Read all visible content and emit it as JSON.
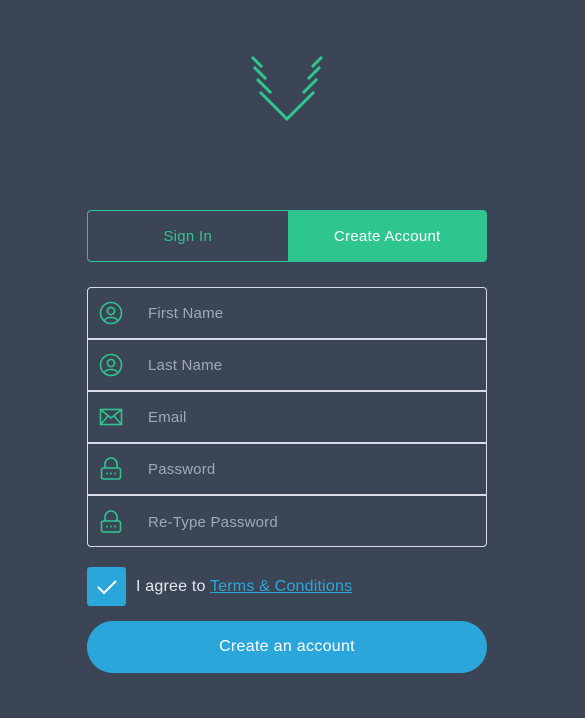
{
  "brand": {
    "logo_icon": "chevron-v-logo-icon",
    "accent_color": "#2ec58f"
  },
  "tabs": [
    {
      "label": "Sign In",
      "active": false
    },
    {
      "label": "Create Account",
      "active": true
    }
  ],
  "form": {
    "fields": [
      {
        "placeholder": "First Name",
        "value": "",
        "icon": "user-icon"
      },
      {
        "placeholder": "Last Name",
        "value": "",
        "icon": "user-icon"
      },
      {
        "placeholder": "Email",
        "value": "",
        "icon": "envelope-icon"
      },
      {
        "placeholder": "Password",
        "value": "",
        "icon": "lock-icon"
      },
      {
        "placeholder": "Re-Type Password",
        "value": "",
        "icon": "lock-icon"
      }
    ]
  },
  "agreement": {
    "checked": true,
    "text": "I agree to ",
    "link_text": "Terms & Conditions"
  },
  "submit": {
    "label": "Create an account",
    "color": "#2ba6db"
  }
}
